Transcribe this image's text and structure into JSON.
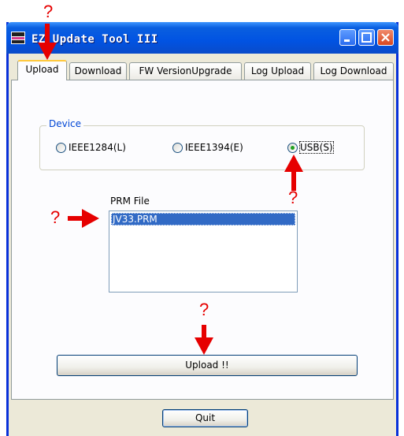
{
  "window": {
    "title": "EZ Update Tool III"
  },
  "tabs": [
    {
      "label": "Upload",
      "active": true
    },
    {
      "label": "Download"
    },
    {
      "label": "FW VersionUpgrade"
    },
    {
      "label": "Log Upload"
    },
    {
      "label": "Log Download"
    }
  ],
  "device": {
    "label": "Device",
    "options": [
      {
        "label": "IEEE1284(L)",
        "checked": false
      },
      {
        "label": "IEEE1394(E)",
        "checked": false
      },
      {
        "label": "USB(S)",
        "checked": true
      }
    ]
  },
  "prm_file": {
    "label": "PRM File",
    "items": [
      "JV33.PRM"
    ],
    "selected": "JV33.PRM"
  },
  "buttons": {
    "upload": "Upload !!",
    "quit": "Quit"
  },
  "annotations": {
    "mark": "?"
  },
  "colors": {
    "annotation": "#e60000",
    "title_bar": "#0153e2",
    "selection": "#316ac5",
    "group_label": "#0046d5"
  }
}
